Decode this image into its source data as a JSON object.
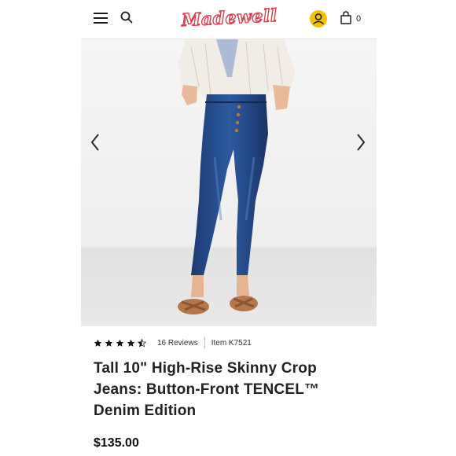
{
  "header": {
    "brand": "Madewell",
    "cart_count": "0",
    "icons": [
      "menu-icon",
      "search-icon",
      "account-icon",
      "bag-icon"
    ],
    "account_color": "#f2c200",
    "brand_color": "#d8424f"
  },
  "gallery": {
    "prev_icon": "chevron-left-icon",
    "next_icon": "chevron-right-icon"
  },
  "product": {
    "rating": 4.5,
    "rating_max": 5,
    "reviews_label": "16 Reviews",
    "item_number": "Item K7521",
    "title": "Tall 10\" High-Rise Skinny Crop Jeans: Button-Front TENCEL™ Denim Edition",
    "price": "$135.00"
  }
}
